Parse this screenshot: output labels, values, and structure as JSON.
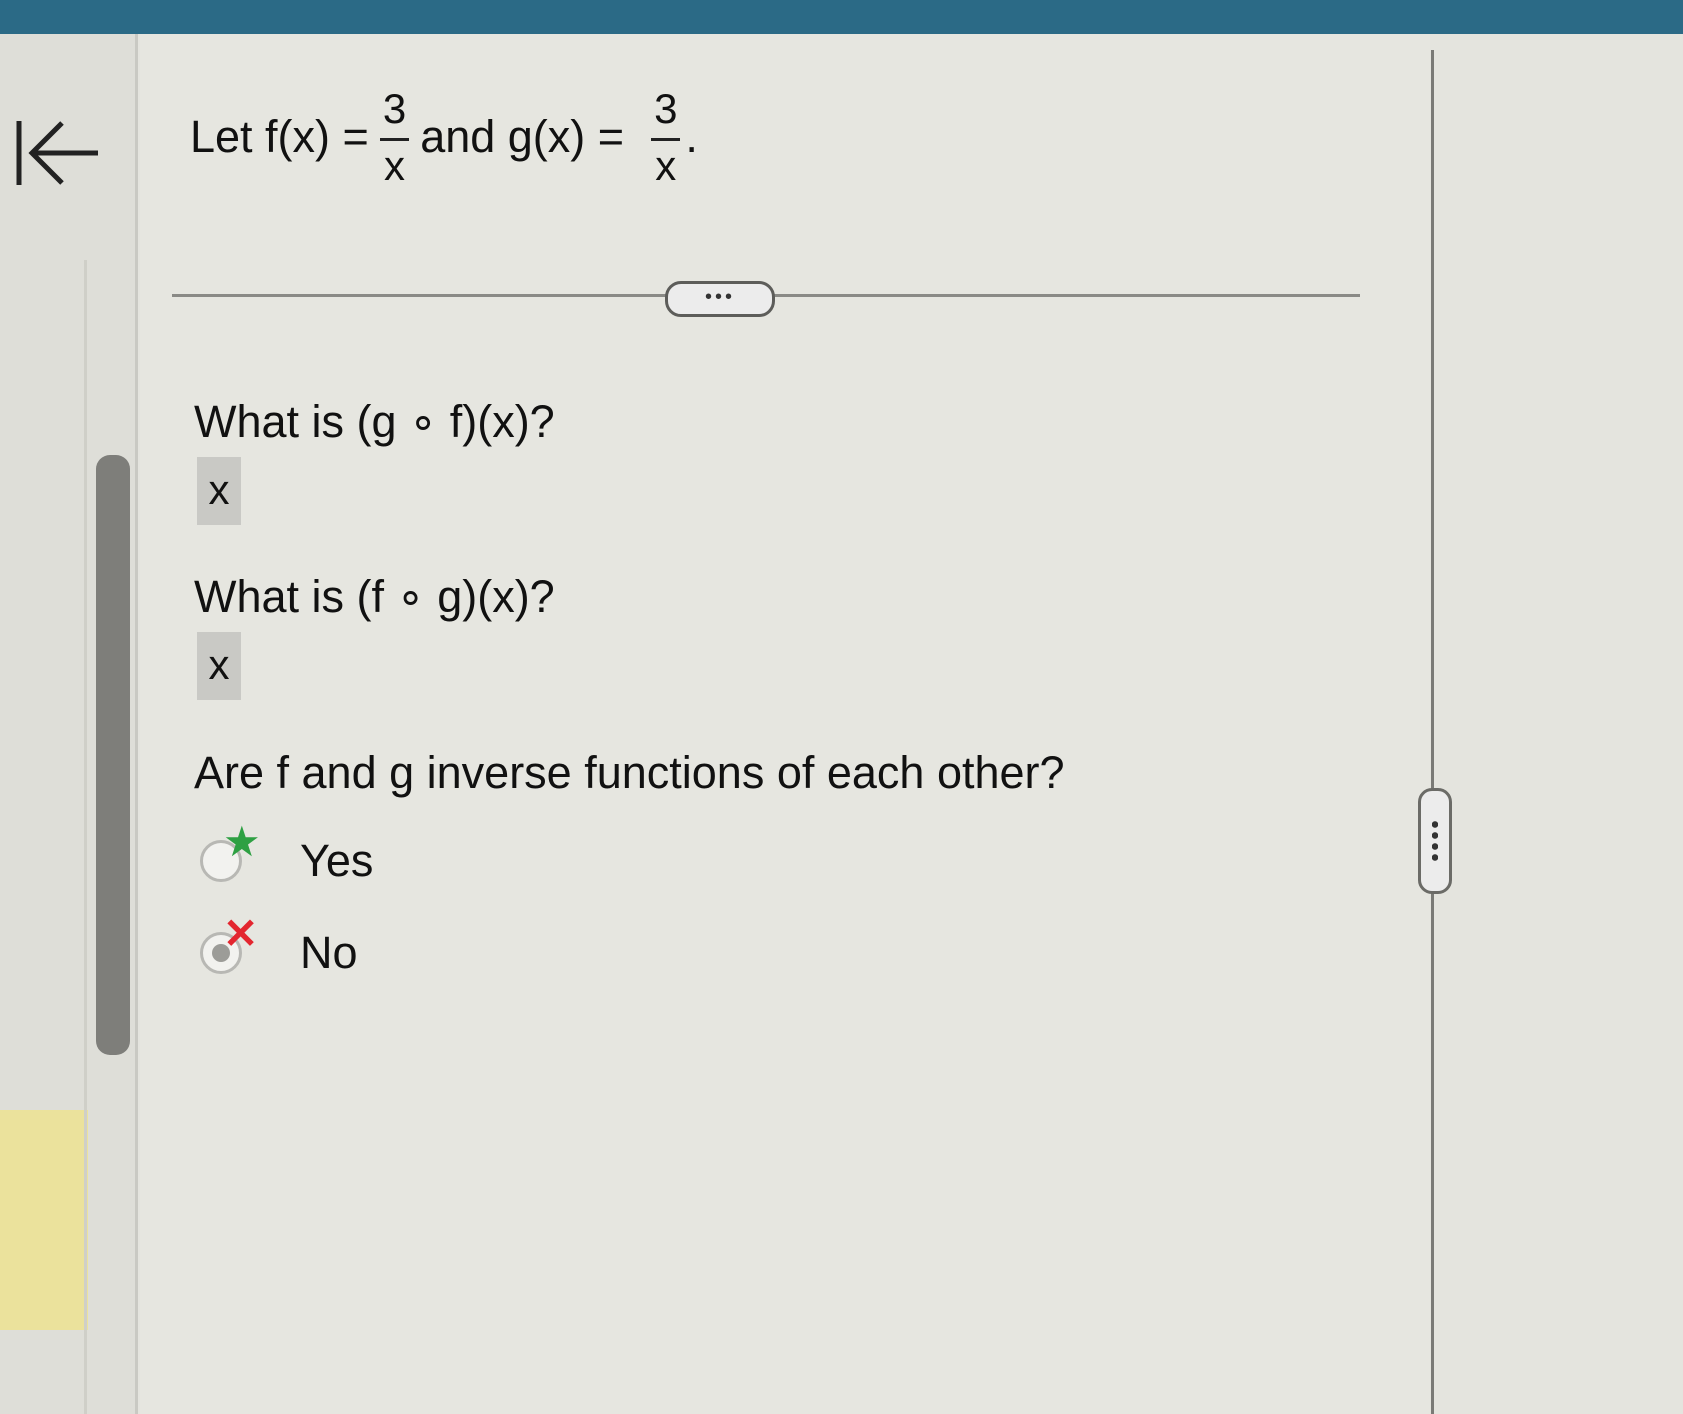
{
  "problem": {
    "prefix": "Let f(x) =",
    "f_num": "3",
    "f_den": "x",
    "middle": "and g(x) =",
    "g_num": "3",
    "g_den": "x",
    "suffix": "."
  },
  "expand_button": {
    "label": "•••"
  },
  "questions": [
    {
      "prompt": "What is (g ∘ f)(x)?",
      "answer": "x"
    },
    {
      "prompt": "What is (f ∘ g)(x)?",
      "answer": "x"
    }
  ],
  "inverse_question": {
    "prompt": "Are f and g inverse functions of each other?",
    "options": [
      {
        "label": "Yes",
        "selected": false,
        "marker": "star-icon",
        "marker_color": "#2ea043"
      },
      {
        "label": "No",
        "selected": true,
        "marker": "x-mark-icon",
        "marker_color": "#e3262f"
      }
    ]
  },
  "colors": {
    "top_bar": "#2b6a86",
    "background": "#e6e6e0",
    "correct": "#2ea043",
    "incorrect": "#e3262f"
  }
}
